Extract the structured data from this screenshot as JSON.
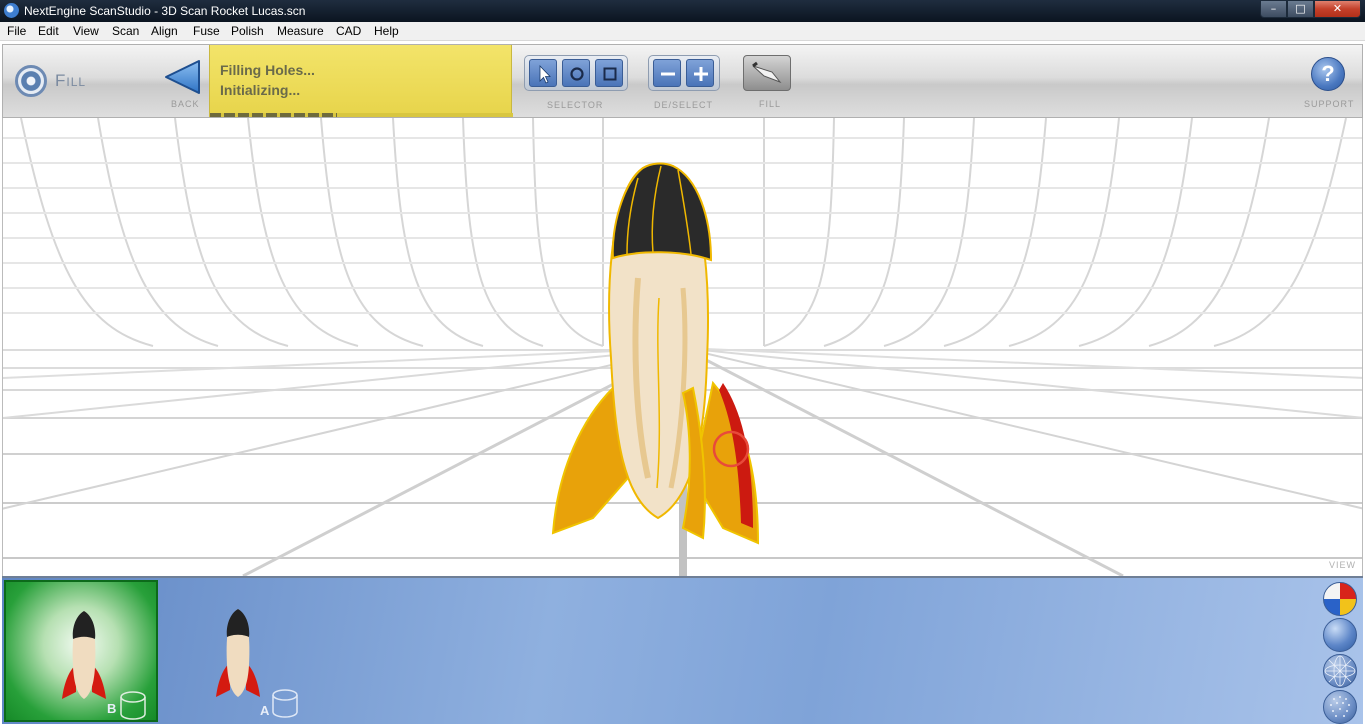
{
  "window": {
    "title": "NextEngine ScanStudio - 3D Scan Rocket Lucas.scn",
    "controls": {
      "minimize": "–",
      "maximize": "□",
      "close": "✕"
    }
  },
  "menu": [
    "File",
    "Edit",
    "View",
    "Scan",
    "Align",
    "Fuse",
    "Polish",
    "Measure",
    "CAD",
    "Help"
  ],
  "toolbar": {
    "mode_label": "Fill",
    "back_caption": "Back",
    "status_line1": "Filling Holes...",
    "status_line2": "Initializing...",
    "progress_fraction": 0.42,
    "selector_caption": "Selector",
    "deselect_caption": "De/Select",
    "fill_caption": "Fill",
    "support_caption": "Support",
    "support_glyph": "?",
    "icons": [
      "fill-mode-icon",
      "back-arrow-icon",
      "pointer-select-icon",
      "circle-select-icon",
      "rect-select-icon",
      "minus-icon",
      "plus-icon",
      "fill-trowel-icon",
      "help-icon"
    ]
  },
  "viewport": {
    "view_label": "View",
    "colors": {
      "rocket_nose": "#2a2a2a",
      "rocket_fins": "#e8a20a",
      "rocket_fin_red": "#cc1a10",
      "rocket_body": "#f2e2c8",
      "hole_outline": "#f0b800",
      "cursor": "#e84a3a"
    }
  },
  "thumbnails": [
    {
      "letter": "B",
      "selected": true
    },
    {
      "letter": "A",
      "selected": false
    }
  ],
  "render_modes": [
    "color-render-icon",
    "smooth-render-icon",
    "wireframe-render-icon",
    "points-render-icon"
  ]
}
